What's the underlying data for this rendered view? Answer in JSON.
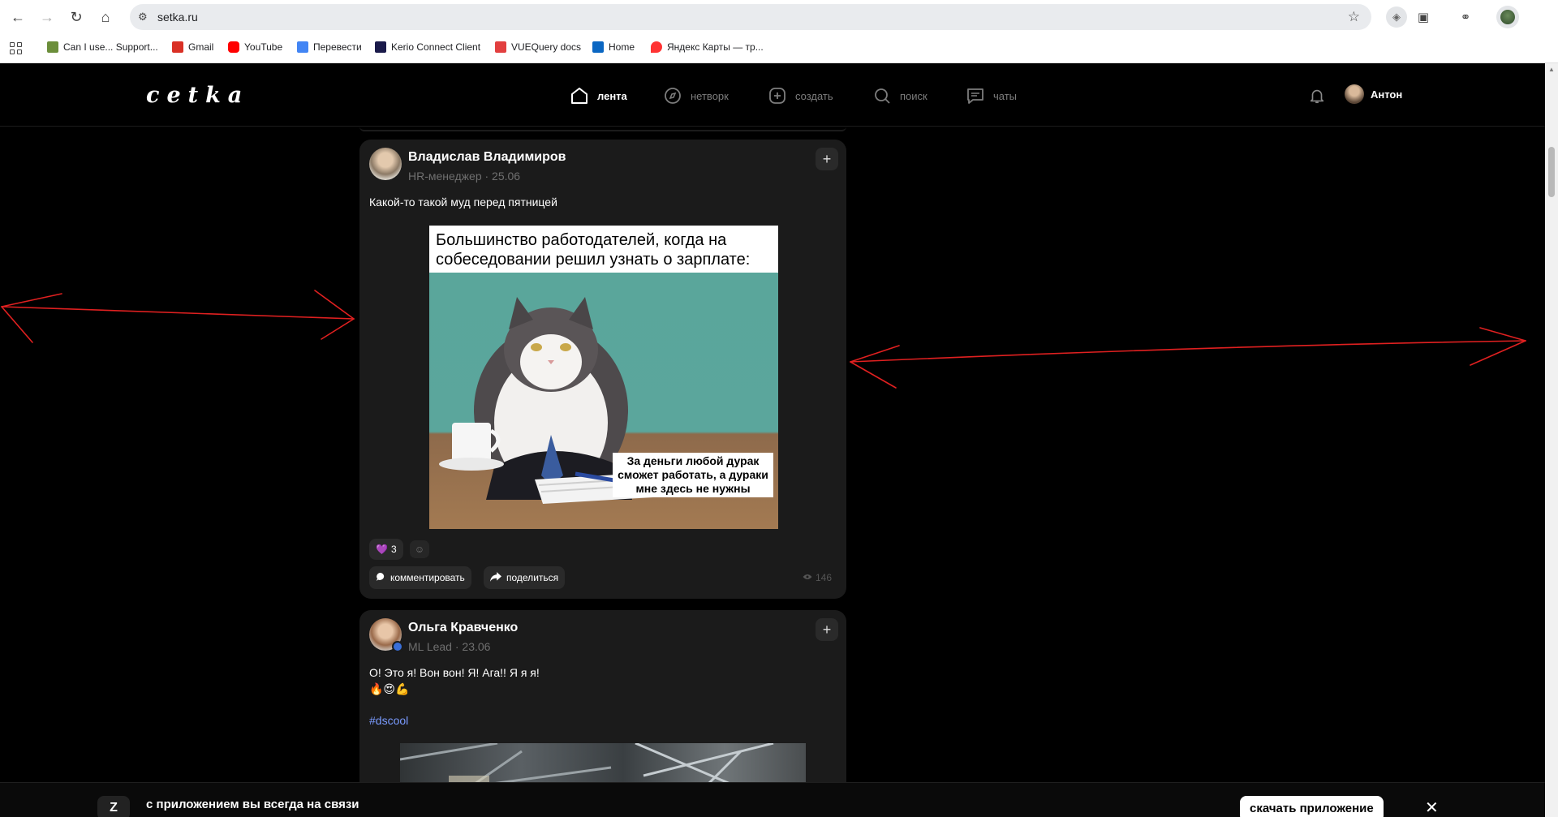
{
  "browser": {
    "url": "setka.ru",
    "bookmarks": [
      {
        "label": "Can I use... Support...",
        "icon": "caniuse-icon",
        "color": "#6b8e3a"
      },
      {
        "label": "Gmail",
        "icon": "gmail-icon",
        "color": "#d93025"
      },
      {
        "label": "YouTube",
        "icon": "youtube-icon",
        "color": "#ff0000"
      },
      {
        "label": "Перевести",
        "icon": "translate-icon",
        "color": "#4285f4"
      },
      {
        "label": "Kerio Connect Client",
        "icon": "kerio-icon",
        "color": "#1a1a4a"
      },
      {
        "label": "VUEQuery docs",
        "icon": "vuequery-icon",
        "color": "#e23f3f"
      },
      {
        "label": "Home",
        "icon": "linkedin-icon",
        "color": "#0a66c2"
      },
      {
        "label": "Яндекс Карты — тр...",
        "icon": "yandex-maps-icon",
        "color": "#f33"
      }
    ]
  },
  "header": {
    "logo": "cetka",
    "nav": [
      {
        "label": "лента",
        "icon": "home-icon",
        "active": true
      },
      {
        "label": "нетворк",
        "icon": "compass-icon",
        "active": false
      },
      {
        "label": "создать",
        "icon": "plus-square-icon",
        "active": false
      },
      {
        "label": "поиск",
        "icon": "search-icon",
        "active": false
      },
      {
        "label": "чаты",
        "icon": "chat-icon",
        "active": false
      }
    ],
    "user_name": "Антон"
  },
  "posts": [
    {
      "author": "Владислав Владимиров",
      "meta": "HR-менеджер · 25.06",
      "text": "Какой-то такой муд перед пятницей",
      "image": {
        "top_text": "Большинство работодателей, когда на собеседовании решил узнать о зарплате:",
        "caption": "За деньги любой дурак сможет работать, а дураки мне здесь не нужны"
      },
      "reaction_emoji": "💜",
      "reaction_count": "3",
      "comment_label": "комментировать",
      "share_label": "поделиться",
      "views": "146"
    },
    {
      "author": "Ольга Кравченко",
      "meta": "ML Lead · 23.06",
      "text_line1": "О! Это я! Вон вон! Я! Ага!! Я я я!",
      "text_line2": "🔥😍💪",
      "hashtag": "#dscool"
    }
  ],
  "banner": {
    "text": "с приложением вы всегда на связи",
    "button": "скачать приложение"
  },
  "colors": {
    "background": "#000000",
    "card": "#1b1b1b",
    "annotation": "#e02020",
    "hashtag": "#7a9bff"
  }
}
